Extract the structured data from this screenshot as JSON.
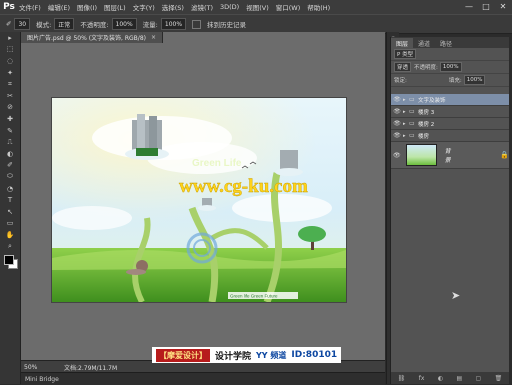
{
  "app": {
    "logo": "Ps"
  },
  "menu": [
    "文件(F)",
    "编辑(E)",
    "图像(I)",
    "图层(L)",
    "文字(Y)",
    "选择(S)",
    "滤镜(T)",
    "3D(D)",
    "视图(V)",
    "窗口(W)",
    "帮助(H)"
  ],
  "window_buttons": [
    "—",
    "□",
    "✕"
  ],
  "options": {
    "size": "30",
    "mode_label": "模式:",
    "mode_value": "正常",
    "opacity_label": "不透明度:",
    "opacity_value": "100%",
    "flow_label": "流量:",
    "flow_value": "100%",
    "check_label": "抹到历史记录"
  },
  "tools": [
    "▸",
    "⬚",
    "◌",
    "✦",
    "⌗",
    "✂",
    "⊘",
    "✚",
    "✎",
    "⎍",
    "◐",
    "✐",
    "⬭",
    "◔",
    "T",
    "↖",
    "▭",
    "✋",
    "⌕"
  ],
  "document": {
    "tab_title": "图片广告.psd @ 50% (文字及装饰, RGB/8)",
    "canvas_brand": "Green Life",
    "canvas_url": "www.cg-ku.com",
    "canvas_footer": "Green life Green Future"
  },
  "status": {
    "zoom": "50%",
    "doc_info": "文档:2.79M/11.7M"
  },
  "timeline_label": "Mini Bridge",
  "watermark": {
    "brand": "【摩爱设计】",
    "text": "设计学院",
    "yy": "YY 频道",
    "id": "ID:80101"
  },
  "panel": {
    "tabs": [
      "图层",
      "通道",
      "路径"
    ],
    "kind_label": "P 类型",
    "blend_mode": "穿透",
    "opacity_label": "不透明度:",
    "opacity_value": "100%",
    "lock_label": "锁定:",
    "fill_label": "填充:",
    "fill_value": "100%",
    "layers": [
      {
        "name": "文字及装饰",
        "selected": true
      },
      {
        "name": "楼房 3",
        "selected": false
      },
      {
        "name": "楼房 2",
        "selected": false
      },
      {
        "name": "楼房",
        "selected": false
      }
    ],
    "background_layer": "背景",
    "footer_icons": [
      "⛓",
      "fx",
      "◐",
      "▤",
      "▢",
      "🗑"
    ]
  },
  "colors": {
    "accent_selected": "#7d8fa9",
    "grass": "#5fae2e",
    "sky": "#d8eef8"
  }
}
